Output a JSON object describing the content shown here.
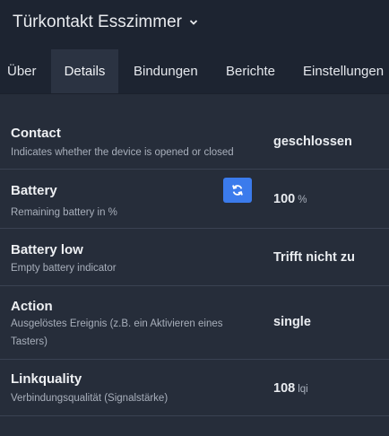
{
  "header": {
    "device_title": "Türkontakt Esszimmer"
  },
  "tabs": [
    {
      "label": "Über"
    },
    {
      "label": "Details"
    },
    {
      "label": "Bindungen"
    },
    {
      "label": "Berichte"
    },
    {
      "label": "Einstellungen"
    }
  ],
  "active_tab": "Details",
  "rows": [
    {
      "name": "Contact",
      "description": "Indicates whether the device is opened or closed",
      "value": "geschlossen",
      "unit": ""
    },
    {
      "name": "Battery",
      "description": "Remaining battery in %",
      "value": "100",
      "unit": "%"
    },
    {
      "name": "Battery low",
      "description": "Empty battery indicator",
      "value": "Trifft nicht zu",
      "unit": ""
    },
    {
      "name": "Action",
      "description": "Ausgelöstes Ereignis (z.B. ein Aktivieren eines Tasters)",
      "value": "single",
      "unit": ""
    },
    {
      "name": "Linkquality",
      "description": "Verbindungsqualität (Signalstärke)",
      "value": "108",
      "unit": "lqi"
    }
  ],
  "icons": {
    "title_dropdown": "chevron-down-icon",
    "battery_refresh": "refresh-icon"
  },
  "colors": {
    "accent": "#3b7bec",
    "background": "#262d3a",
    "header": "#1d2431"
  }
}
